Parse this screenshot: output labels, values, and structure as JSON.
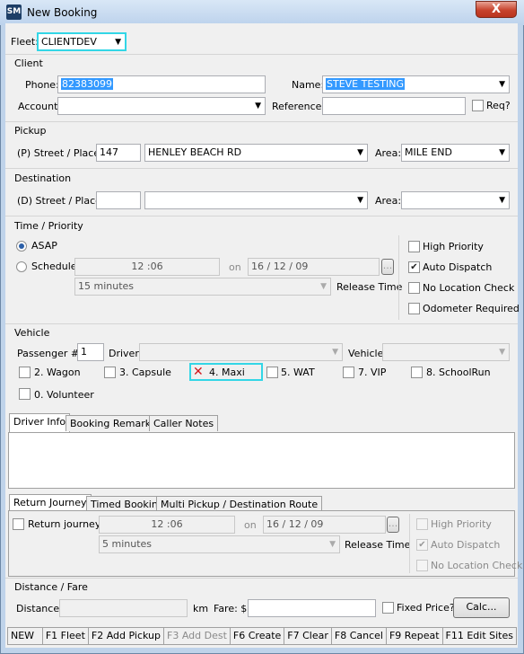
{
  "window": {
    "title": "New Booking",
    "app_icon": "SM",
    "close_label": "X"
  },
  "fleet": {
    "label": "Fleet:",
    "value": "CLIENTDEV"
  },
  "client": {
    "heading": "Client",
    "phone_label": "Phone:",
    "phone_value": "82383099",
    "name_label": "Name:",
    "name_value": "STEVE TESTING",
    "account_label": "Account:",
    "account_value": "",
    "reference_label": "Reference:",
    "reference_value": "",
    "req_label": "Req?"
  },
  "pickup": {
    "heading": "Pickup",
    "street_label": "(P) Street / Place:",
    "number": "147",
    "street": "HENLEY BEACH RD",
    "area_label": "Area:",
    "area": "MILE END"
  },
  "destination": {
    "heading": "Destination",
    "street_label": "(D) Street / Place:",
    "number": "",
    "street": "",
    "area_label": "Area:",
    "area": ""
  },
  "time": {
    "heading": "Time / Priority",
    "asap_label": "ASAP",
    "schedule_label": "Schedule",
    "time_hh": "12",
    "time_mm": ":06",
    "on_label": "on",
    "date": "16 / 12 / 09",
    "date_btn": "...",
    "release_value": "15 minutes",
    "release_label": "Release Time",
    "high_priority": "High Priority",
    "auto_dispatch": "Auto Dispatch",
    "no_location": "No Location Check",
    "odometer": "Odometer Required"
  },
  "vehicle": {
    "heading": "Vehicle",
    "passenger_label": "Passenger #:",
    "passenger_value": "1",
    "driver_label": "Driver:",
    "vehicle_label": "Vehicle:",
    "types": [
      "2. Wagon",
      "3. Capsule",
      "4. Maxi",
      "5. WAT",
      "7. VIP",
      "8. SchoolRun",
      "0. Volunteer"
    ]
  },
  "info_tabs": [
    "Driver Info",
    "Booking Remarks",
    "Caller Notes"
  ],
  "return_tabs": [
    "Return Journey",
    "Timed Booking",
    "Multi Pickup / Destination Route"
  ],
  "return": {
    "checkbox_label": "Return journey",
    "time_hh": "12",
    "time_mm": ":06",
    "on_label": "on",
    "date": "16 / 12 / 09",
    "date_btn": "...",
    "release_value": "5 minutes",
    "release_label": "Release Time",
    "high_priority": "High Priority",
    "auto_dispatch": "Auto Dispatch",
    "no_location": "No Location Check"
  },
  "fare": {
    "heading": "Distance / Fare",
    "distance_label": "Distance:",
    "distance_value": "",
    "km_label": "km",
    "fare_label": "Fare: $",
    "fare_value": "",
    "fixed_label": "Fixed Price?",
    "calc_label": "Calc..."
  },
  "status_bar": [
    "NEW",
    "F1 Fleet",
    "F2 Add Pickup",
    "F3 Add Dest",
    "F6 Create",
    "F7 Clear",
    "F8 Cancel",
    "F9 Repeat",
    "F11 Edit Sites"
  ]
}
